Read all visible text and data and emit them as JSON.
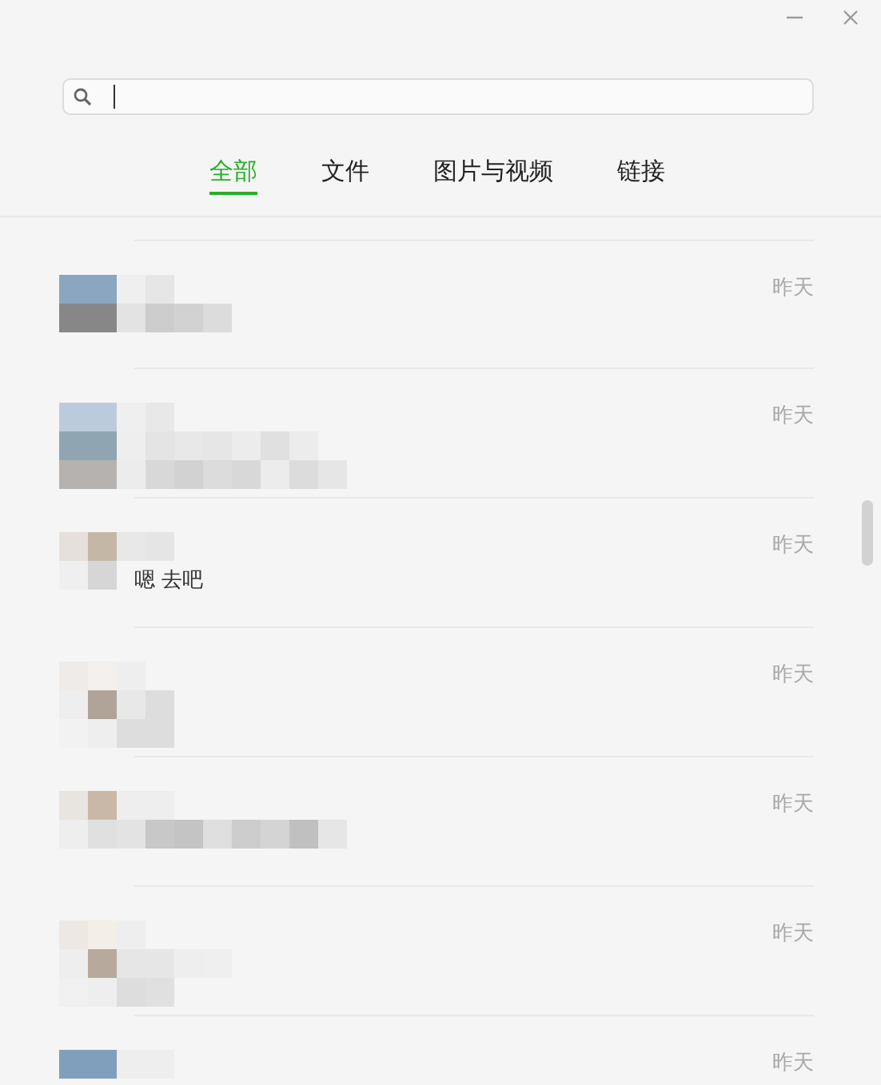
{
  "search": {
    "focused": true
  },
  "tabs": [
    {
      "label": "全部",
      "selected": true
    },
    {
      "label": "文件",
      "selected": false
    },
    {
      "label": "图片与视频",
      "selected": false
    },
    {
      "label": "链接",
      "selected": false
    }
  ],
  "results": [
    {
      "time": "昨天"
    },
    {
      "time": "昨天"
    },
    {
      "time": "昨天",
      "message": "嗯 去吧"
    },
    {
      "time": "昨天"
    },
    {
      "time": "昨天"
    },
    {
      "time": "昨天"
    },
    {
      "time": "昨天"
    }
  ]
}
